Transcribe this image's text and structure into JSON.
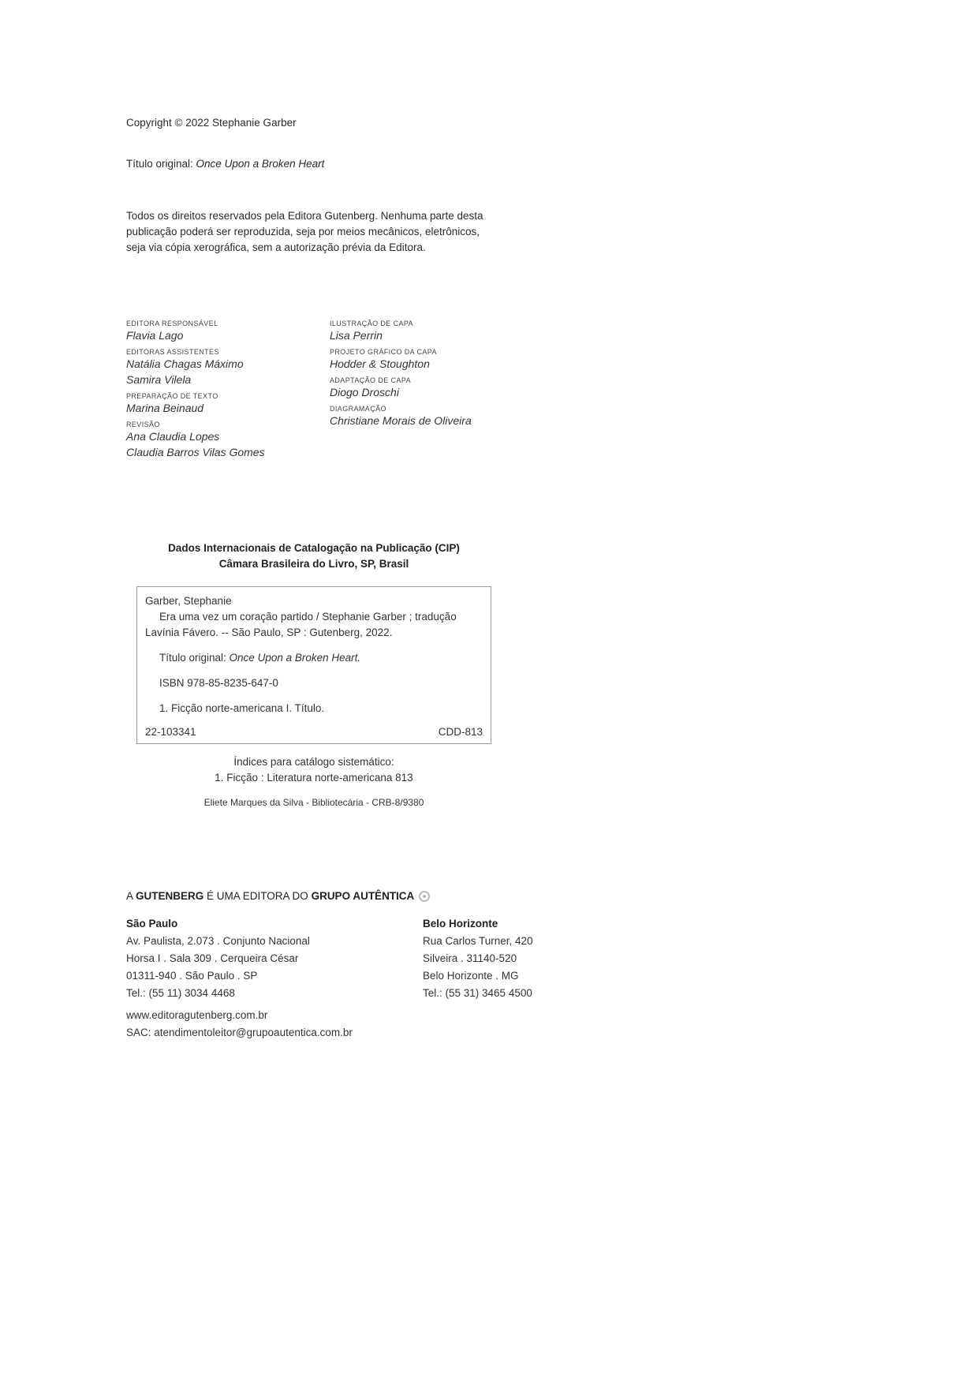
{
  "copyright": "Copyright © 2022 Stephanie Garber",
  "original_title": {
    "label": "Título original: ",
    "value": "Once Upon a Broken Heart"
  },
  "rights": [
    "Todos os direitos reservados pela Editora Gutenberg. Nenhuma parte desta",
    "publicação poderá ser reproduzida, seja por meios mecânicos, eletrônicos,",
    "seja via cópia xerográfica, sem a autorização prévia da Editora."
  ],
  "credits_left": [
    {
      "label": "Editora responsável",
      "names": [
        "Flavia Lago"
      ]
    },
    {
      "label": "Editoras assistentes",
      "names": [
        "Natália Chagas Máximo",
        "Samira Vilela"
      ]
    },
    {
      "label": "Preparação de texto",
      "names": [
        "Marina Beinaud"
      ]
    },
    {
      "label": "Revisão",
      "names": [
        "Ana Claudia Lopes",
        "Claudia Barros Vilas Gomes"
      ]
    }
  ],
  "credits_right": [
    {
      "label": "Ilustração de capa",
      "names": [
        "Lisa Perrin"
      ]
    },
    {
      "label": "Projeto gráfico da capa",
      "names": [
        "Hodder & Stoughton"
      ]
    },
    {
      "label": "Adaptação de capa",
      "names": [
        "Diogo Droschi"
      ]
    },
    {
      "label": "Diagramação",
      "names": [
        "Christiane Morais de Oliveira"
      ]
    }
  ],
  "cip": {
    "heading1": "Dados Internacionais de Catalogação na Publicação (CIP)",
    "heading2": "Câmara Brasileira do Livro, SP, Brasil",
    "author": "Garber, Stephanie",
    "entry_line1": "Era uma vez um coração partido / Stephanie Garber ; tradução",
    "entry_line2": "Lavínia Fávero. -- São Paulo, SP : Gutenberg, 2022.",
    "original_label": "Título original: ",
    "original_title": "Once Upon a Broken Heart.",
    "isbn": "ISBN 978-85-8235-647-0",
    "subjects": "1. Ficção norte-americana I. Título.",
    "record_number": "22-103341",
    "cdd": "CDD-813"
  },
  "index": {
    "title": "Índices para catálogo sistemático:",
    "entry": "1. Ficção : Literatura norte-americana 813"
  },
  "librarian": "Eliete Marques da Silva - Bibliotecária - CRB-8/9380",
  "footer": {
    "prefix": "A ",
    "brand": "GUTENBERG",
    "middle": " É UMA EDITORA DO ",
    "group": "GRUPO AUTÊNTICA",
    "logo_icon": "grupo-autentica-logo-icon"
  },
  "offices": {
    "sao_paulo": {
      "title": "São Paulo",
      "lines": [
        "Av. Paulista, 2.073 . Conjunto Nacional",
        "Horsa I . Sala 309 . Cerqueira César",
        "01311-940 . São Paulo . SP",
        "Tel.: (55 11) 3034 4468"
      ]
    },
    "belo_horizonte": {
      "title": "Belo Horizonte",
      "lines": [
        "Rua Carlos Turner, 420",
        "Silveira . 31140-520",
        "Belo Horizonte . MG",
        "Tel.: (55 31) 3465 4500"
      ]
    }
  },
  "website": "www.editoragutenberg.com.br",
  "sac": "SAC: atendimentoleitor@grupoautentica.com.br"
}
